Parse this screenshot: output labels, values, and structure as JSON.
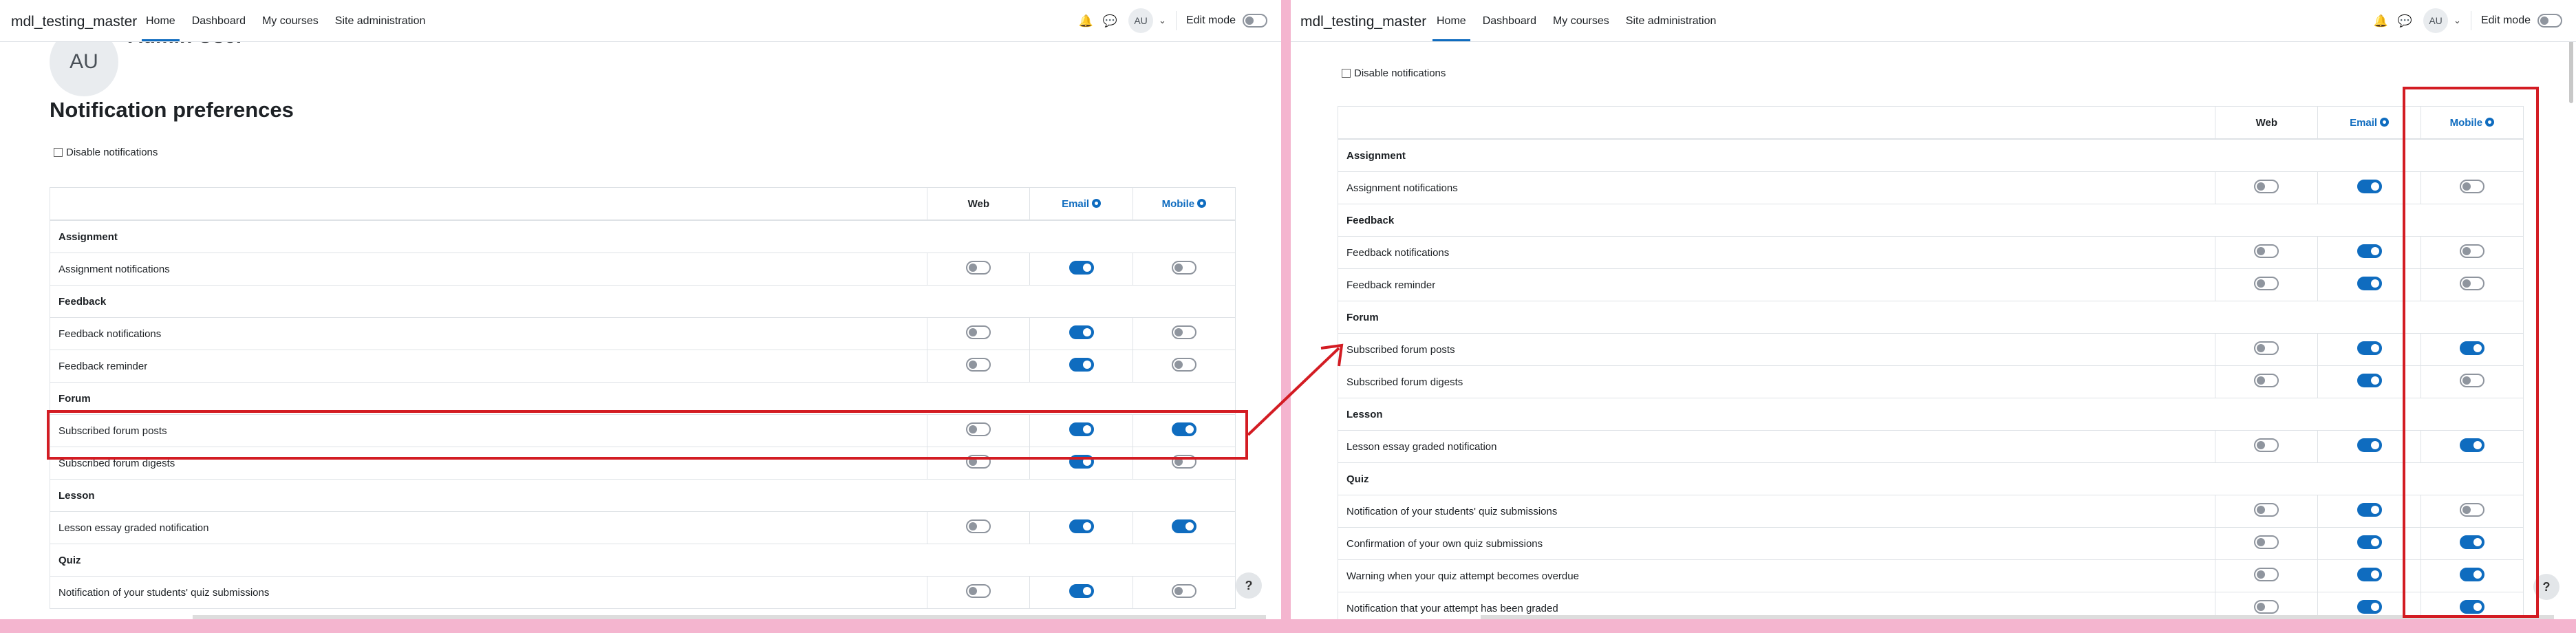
{
  "app": {
    "site_name": "mdl_testing_master",
    "nav": [
      "Home",
      "Dashboard",
      "My courses",
      "Site administration"
    ],
    "avatar_initials": "AU",
    "edit_mode_label": "Edit mode",
    "icons": {
      "notifications": "bell-icon",
      "messages": "chat-bubble-icon",
      "user_menu": "chevron-down-icon",
      "help": "question-icon",
      "settings": "gear-icon"
    }
  },
  "profile": {
    "avatar_initials": "AU",
    "name": "Admin User"
  },
  "page": {
    "title": "Notification preferences",
    "disable_label": "Disable notifications"
  },
  "table": {
    "headers": {
      "web": "Web",
      "email": "Email",
      "mobile": "Mobile"
    }
  },
  "rows": [
    {
      "type": "component",
      "label": "Assignment"
    },
    {
      "type": "pref",
      "label": "Assignment notifications",
      "web": false,
      "email": true,
      "mobile": false
    },
    {
      "type": "component",
      "label": "Feedback"
    },
    {
      "type": "pref",
      "label": "Feedback notifications",
      "web": false,
      "email": true,
      "mobile": false
    },
    {
      "type": "pref",
      "label": "Feedback reminder",
      "web": false,
      "email": true,
      "mobile": false
    },
    {
      "type": "component",
      "label": "Forum"
    },
    {
      "type": "pref",
      "label": "Subscribed forum posts",
      "web": false,
      "email": true,
      "mobile": true
    },
    {
      "type": "pref",
      "label": "Subscribed forum digests",
      "web": false,
      "email": true,
      "mobile": false
    },
    {
      "type": "component",
      "label": "Lesson"
    },
    {
      "type": "pref",
      "label": "Lesson essay graded notification",
      "web": false,
      "email": true,
      "mobile": true
    },
    {
      "type": "component",
      "label": "Quiz"
    },
    {
      "type": "pref",
      "label": "Notification of your students' quiz submissions",
      "web": false,
      "email": true,
      "mobile": false
    },
    {
      "type": "pref",
      "label": "Confirmation of your own quiz submissions",
      "web": false,
      "email": true,
      "mobile": true
    },
    {
      "type": "pref",
      "label": "Warning when your quiz attempt becomes overdue",
      "web": false,
      "email": true,
      "mobile": true
    },
    {
      "type": "pref",
      "label": "Notification that your attempt has been graded",
      "web": false,
      "email": true,
      "mobile": true
    }
  ],
  "annotation_color": "#d31c23",
  "accent_color": "#0f6cbf"
}
